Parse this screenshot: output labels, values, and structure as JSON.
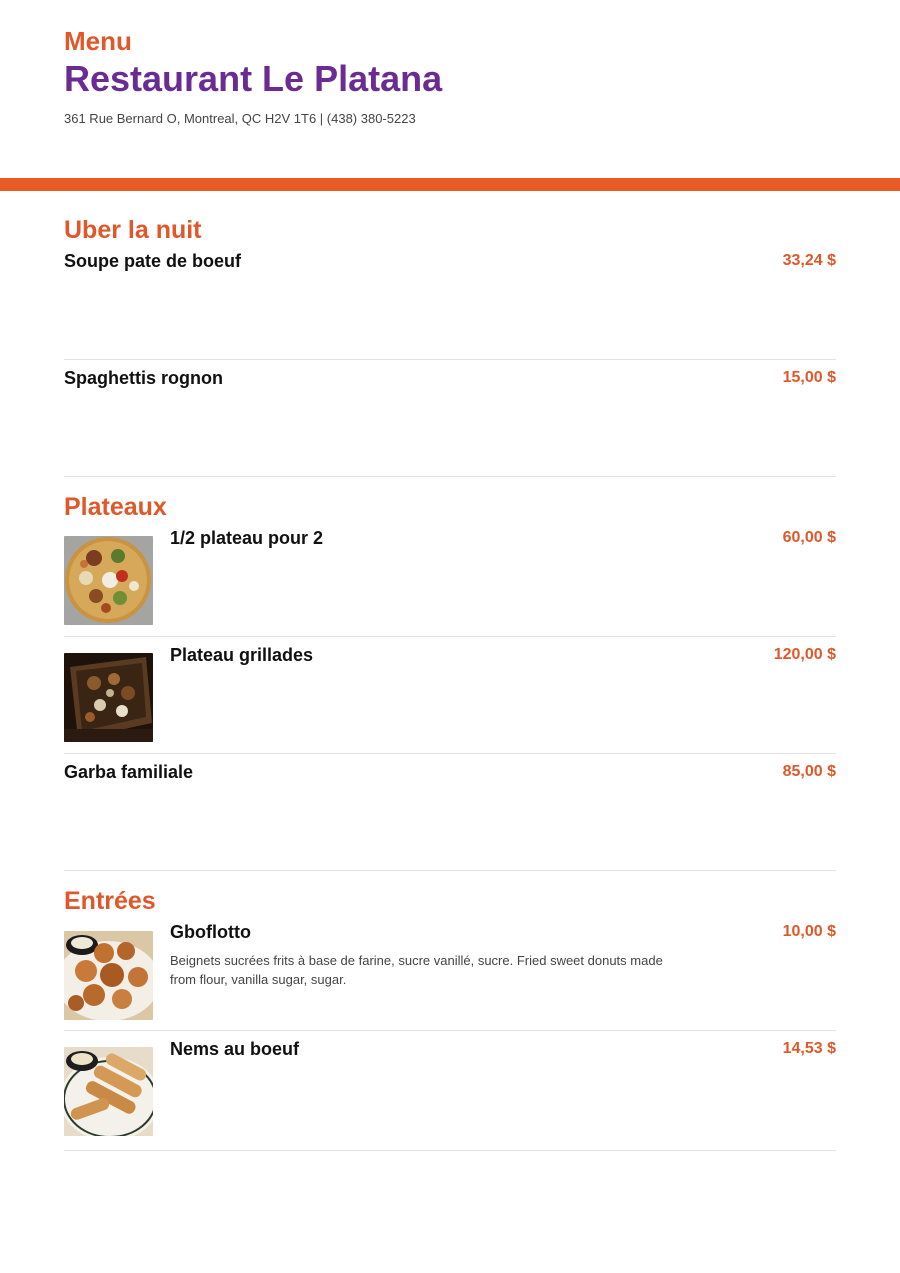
{
  "header": {
    "menu_label": "Menu",
    "restaurant_name": "Restaurant Le Platana",
    "address": "361 Rue Bernard O, Montreal, QC H2V 1T6 | (438) 380-5223"
  },
  "colors": {
    "accent": "#e0582a",
    "band": "#e95a27",
    "brand": "#6a2b93"
  },
  "sections": [
    {
      "title": "Uber la nuit",
      "items": [
        {
          "name": "Soupe pate de boeuf",
          "price": "33,24 $"
        },
        {
          "name": "Spaghettis rognon",
          "price": "15,00 $"
        }
      ]
    },
    {
      "title": "Plateaux",
      "items": [
        {
          "name": "1/2 plateau pour 2",
          "price": "60,00 $",
          "image": "platter-photo"
        },
        {
          "name": "Plateau grillades",
          "price": "120,00 $",
          "image": "grill-platter-photo"
        },
        {
          "name": "Garba familiale",
          "price": "85,00 $"
        }
      ]
    },
    {
      "title": "Entrées",
      "items": [
        {
          "name": "Gboflotto",
          "price": "10,00 $",
          "image": "donuts-photo",
          "description": "Beignets sucrées frits à base de farine, sucre vanillé, sucre. Fried sweet donuts made from flour, vanilla sugar, sugar."
        },
        {
          "name": "Nems au boeuf",
          "price": "14,53 $",
          "image": "spring-rolls-photo"
        }
      ]
    }
  ]
}
